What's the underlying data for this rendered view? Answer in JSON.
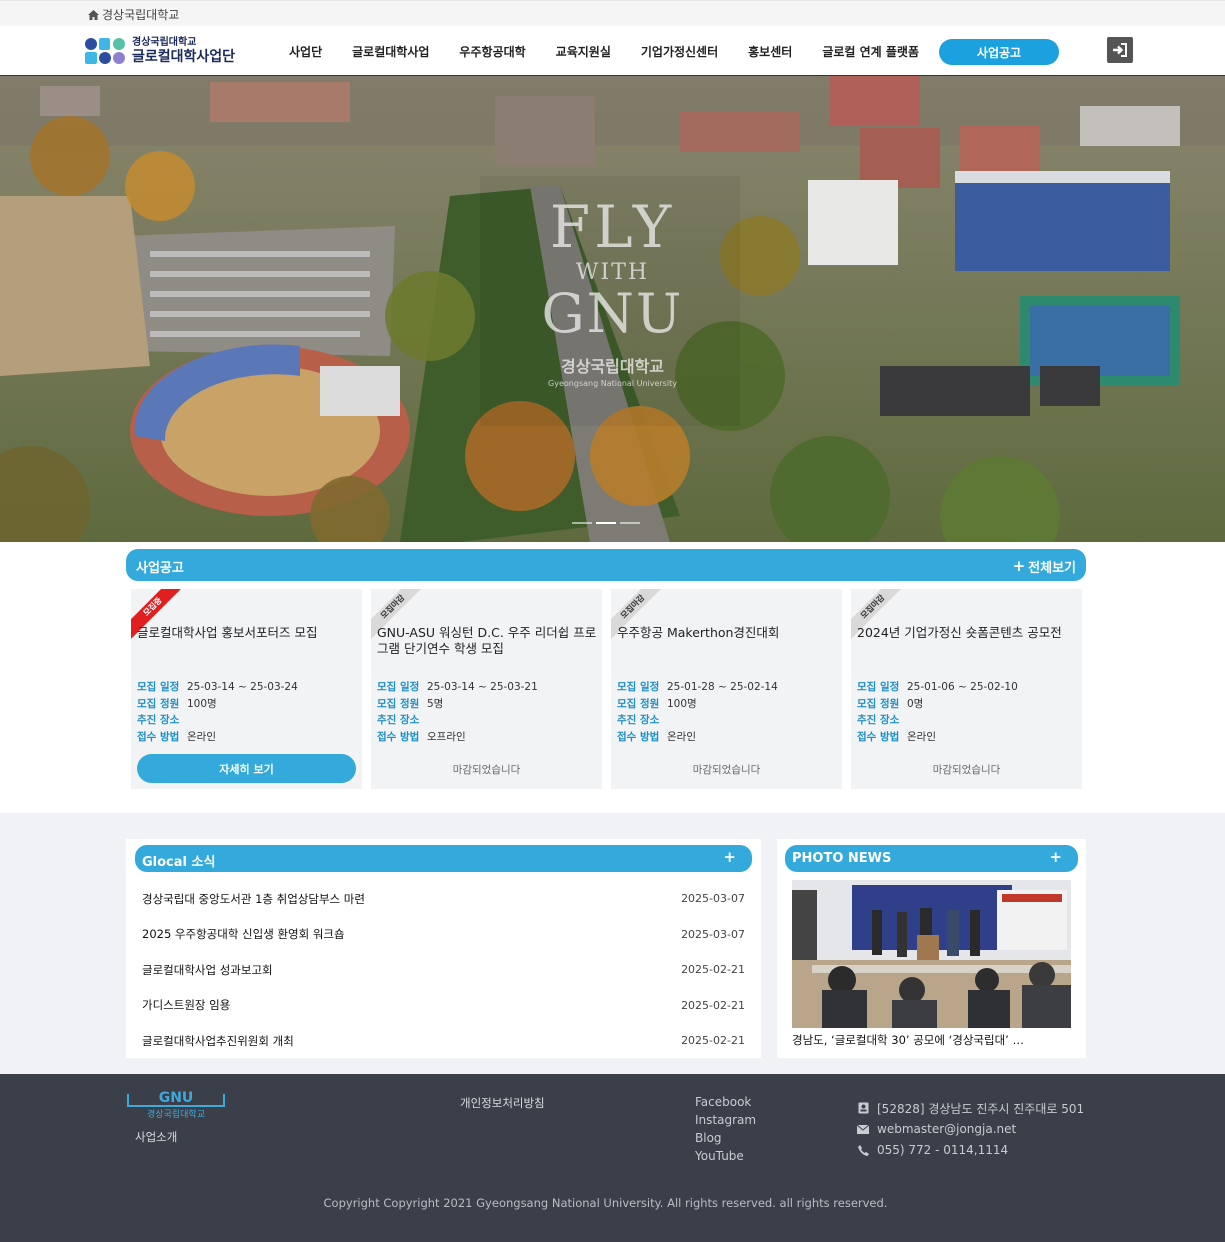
{
  "topbar": {
    "home_label": "경상국립대학교"
  },
  "header": {
    "logo_line1": "경상국립대학교",
    "logo_line2": "글로컬대학사업단",
    "nav": [
      "사업단",
      "글로컬대학사업",
      "우주항공대학",
      "교육지원실",
      "기업가정신센터",
      "홍보센터",
      "글로컬 연계 플랫폼"
    ],
    "cta_label": "사업공고"
  },
  "hero": {
    "line1": "FLY",
    "line2": "WITH",
    "line3": "GNU",
    "univ_ko": "경상국립대학교",
    "univ_en": "Gyeongsang National University",
    "slide_count": 3,
    "active_slide": 2
  },
  "notices": {
    "title": "사업공고",
    "view_all": "전체보기",
    "field_labels": {
      "period": "모집 일정",
      "capacity": "모집 정원",
      "place": "추진 장소",
      "method": "접수 방법"
    },
    "cards": [
      {
        "status": "모집중",
        "title": "글로컬대학사업 홍보서포터즈 모집",
        "period": "25-03-14 ~ 25-03-24",
        "capacity": "100명",
        "place": "",
        "method": "온라인",
        "action": "자세히 보기"
      },
      {
        "status": "모집마감",
        "title": "GNU-ASU 워싱턴 D.C. 우주 리더쉽 프로그램 단기연수 학생 모집",
        "period": "25-03-14 ~ 25-03-21",
        "capacity": "5명",
        "place": "",
        "method": "오프라인",
        "action": "마감되었습니다"
      },
      {
        "status": "모집마감",
        "title": "우주항공 Makerthon경진대회",
        "period": "25-01-28 ~ 25-02-14",
        "capacity": "100명",
        "place": "",
        "method": "온라인",
        "action": "마감되었습니다"
      },
      {
        "status": "모집마감",
        "title": "2024년 기업가정신 숏폼콘텐츠 공모전",
        "period": "25-01-06 ~ 25-02-10",
        "capacity": "0명",
        "place": "",
        "method": "온라인",
        "action": "마감되었습니다"
      }
    ]
  },
  "glocal_news": {
    "title": "Glocal 소식",
    "items": [
      {
        "title": "경상국립대 중앙도서관 1층 취업상담부스 마련",
        "date": "2025-03-07"
      },
      {
        "title": "2025 우주항공대학 신입생 환영회 워크숍",
        "date": "2025-03-07"
      },
      {
        "title": "글로컬대학사업 성과보고회",
        "date": "2025-02-21"
      },
      {
        "title": "가디스트원장 임용",
        "date": "2025-02-21"
      },
      {
        "title": "글로컬대학사업추진위원회 개최",
        "date": "2025-02-21"
      }
    ]
  },
  "photo_news": {
    "title": "PHOTO NEWS",
    "caption": "경남도, ‘글로컬대학 30’ 공모에 ‘경상국립대’ …"
  },
  "footer": {
    "about": "사업소개",
    "privacy": "개인정보처리방침",
    "social": [
      "Facebook",
      "Instagram",
      "Blog",
      "YouTube"
    ],
    "address": "[52828] 경상남도 진주시 진주대로 501",
    "email": "webmaster@jongja.net",
    "phone": "055) 772 - 0114,1114",
    "copyright": "Copyright Copyright 2021 Gyeongsang National University. All rights reserved. all rights reserved."
  },
  "colors": {
    "accent": "#33a9dc",
    "cta": "#1ba1dd",
    "open_ribbon": "#e02020",
    "footer_bg": "#3a3f4a"
  }
}
